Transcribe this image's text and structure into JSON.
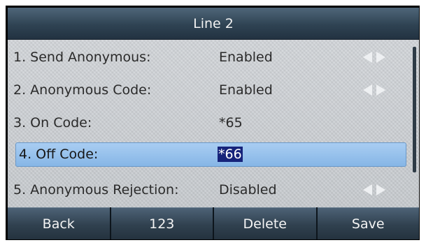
{
  "title": "Line 2",
  "rows": [
    {
      "label": "1. Send Anonymous:",
      "value": "Enabled",
      "has_arrows": true
    },
    {
      "label": "2. Anonymous Code:",
      "value": "Enabled",
      "has_arrows": true
    },
    {
      "label": "3. On Code:",
      "value": "*65",
      "has_arrows": false
    },
    {
      "label": "4. Off Code:",
      "value": "*66",
      "has_arrows": false,
      "selected": true
    },
    {
      "label": "5. Anonymous Rejection:",
      "value": "Disabled",
      "has_arrows": true
    }
  ],
  "icons": {
    "left": "arrow-left-icon",
    "right": "arrow-right-icon"
  },
  "softkeys": [
    "Back",
    "123",
    "Delete",
    "Save"
  ],
  "colors": {
    "selection": "#86b6e6",
    "text_highlight": "#16237a",
    "title_bar": "#2f4353"
  }
}
